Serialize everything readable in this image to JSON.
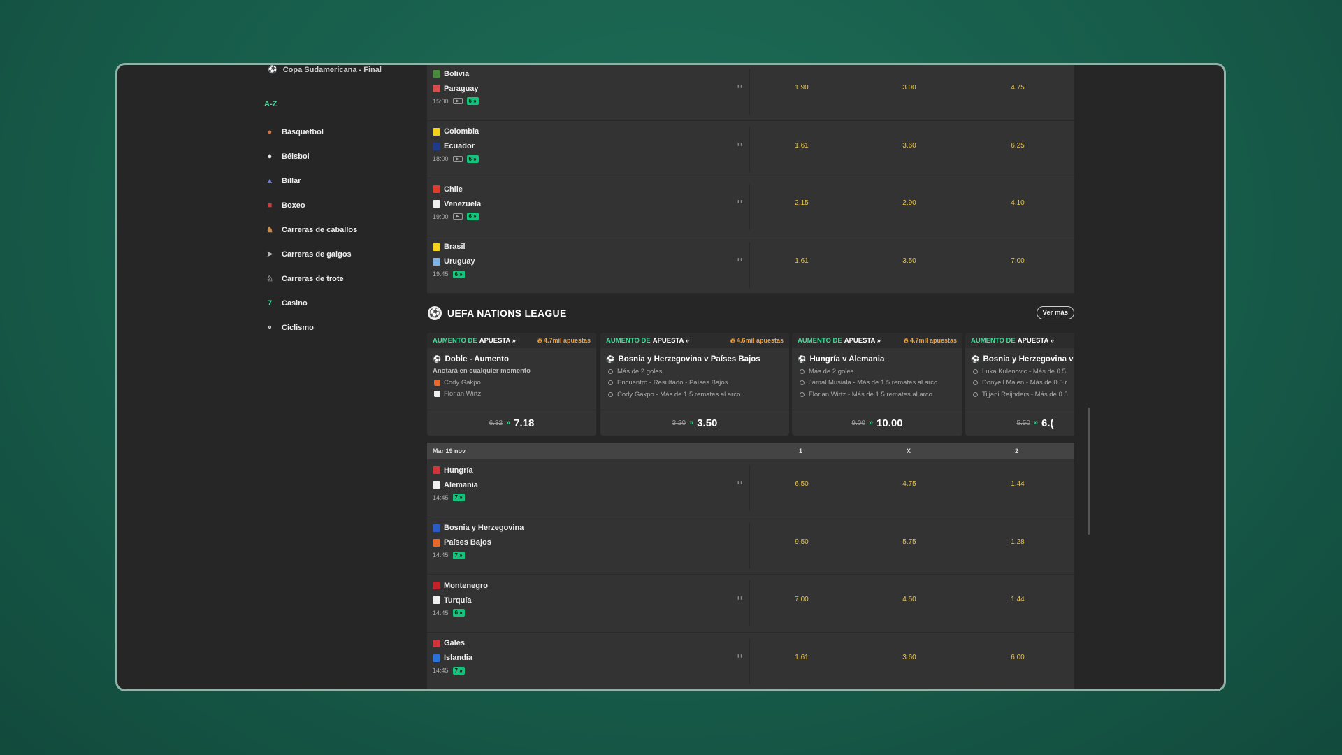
{
  "sidebar": {
    "top_item": "Copa Sudamericana - Final",
    "az_label": "A-Z",
    "sports": [
      {
        "label": "Básquetbol",
        "icon": "basketball-icon",
        "color": "#d9743c"
      },
      {
        "label": "Béisbol",
        "icon": "baseball-icon",
        "color": "#e9e9e9"
      },
      {
        "label": "Billar",
        "icon": "billiards-icon",
        "color": "#6c7bd8"
      },
      {
        "label": "Boxeo",
        "icon": "boxing-glove-icon",
        "color": "#d23a3a"
      },
      {
        "label": "Carreras de caballos",
        "icon": "horse-icon",
        "color": "#c98a4a"
      },
      {
        "label": "Carreras de galgos",
        "icon": "greyhound-icon",
        "color": "#b9b9b9"
      },
      {
        "label": "Carreras de trote",
        "icon": "trotting-icon",
        "color": "#999999"
      },
      {
        "label": "Casino",
        "icon": "slot-777-icon",
        "color": "#3ddc97"
      },
      {
        "label": "Ciclismo",
        "icon": "bicycle-icon",
        "color": "#cccccc"
      }
    ]
  },
  "top_matches": [
    {
      "home": "Bolivia",
      "away": "Paraguay",
      "time": "15:00",
      "tv": true,
      "markets": "6 »",
      "stats": true,
      "odd1": "1.90",
      "oddx": "3.00",
      "odd2": "4.75",
      "home_color": "#4a8a3c",
      "away_color": "#d94c4c"
    },
    {
      "home": "Colombia",
      "away": "Ecuador",
      "time": "18:00",
      "tv": true,
      "markets": "6 »",
      "stats": true,
      "odd1": "1.61",
      "oddx": "3.60",
      "odd2": "6.25",
      "home_color": "#f2d21c",
      "away_color": "#1f3a8a"
    },
    {
      "home": "Chile",
      "away": "Venezuela",
      "time": "19:00",
      "tv": true,
      "markets": "6 »",
      "stats": true,
      "odd1": "2.15",
      "oddx": "2.90",
      "odd2": "4.10",
      "home_color": "#e03a2c",
      "away_color": "#f0f0f0"
    },
    {
      "home": "Brasil",
      "away": "Uruguay",
      "time": "19:45",
      "tv": false,
      "markets": "6 »",
      "stats": true,
      "odd1": "1.61",
      "oddx": "3.50",
      "odd2": "7.00",
      "home_color": "#f2d21c",
      "away_color": "#7fb4e8"
    }
  ],
  "league": {
    "title": "UEFA NATIONS LEAGUE",
    "more": "Ver más"
  },
  "boosts": [
    {
      "tag_a": "AUMENTO DE",
      "tag_b": "APUESTA »",
      "pop": "4.7mil apuestas",
      "title": "Doble - Aumento",
      "subtitle": "Anotará en cualquier momento",
      "legs": [
        "Cody Gakpo",
        "Florian Wirtz"
      ],
      "leg_colors": [
        "#e8692a",
        "#f0f0f0"
      ],
      "old": "6.32",
      "new": "7.18"
    },
    {
      "tag_a": "AUMENTO DE",
      "tag_b": "APUESTA »",
      "pop": "4.6mil apuestas",
      "title": "Bosnia y Herzegovina v Países Bajos",
      "subtitle": "",
      "legs": [
        "Más de 2 goles",
        "Encuentro - Resultado - Países Bajos",
        "Cody Gakpo - Más de 1.5 remates al arco"
      ],
      "old": "3.20",
      "new": "3.50"
    },
    {
      "tag_a": "AUMENTO DE",
      "tag_b": "APUESTA »",
      "pop": "4.7mil apuestas",
      "title": "Hungría v Alemania",
      "subtitle": "",
      "legs": [
        "Más de 2 goles",
        "Jamal Musiala - Más de 1.5 remates al arco",
        "Florian Wirtz - Más de 1.5 remates al arco"
      ],
      "old": "9.00",
      "new": "10.00"
    },
    {
      "tag_a": "AUMENTO DE",
      "tag_b": "APUESTA »",
      "pop": "",
      "title": "Bosnia y Herzegovina v",
      "subtitle": "",
      "legs": [
        "Luka Kulenovic - Más de 0.5",
        "Donyell Malen - Más de 0.5 r",
        "Tijjani Reijnders - Más de 0.5"
      ],
      "old": "5.50",
      "new": "6.("
    }
  ],
  "day_header": {
    "date": "Mar 19 nov",
    "col1": "1",
    "colx": "X",
    "col2": "2"
  },
  "nations_matches": [
    {
      "home": "Hungría",
      "away": "Alemania",
      "time": "14:45",
      "markets": "7 »",
      "stats": true,
      "odd1": "6.50",
      "oddx": "4.75",
      "odd2": "1.44",
      "home_color": "#d2343a",
      "away_color": "#f0f0f0"
    },
    {
      "home": "Bosnia y Herzegovina",
      "away": "Países Bajos",
      "time": "14:45",
      "markets": "7 »",
      "stats": false,
      "odd1": "9.50",
      "oddx": "5.75",
      "odd2": "1.28",
      "home_color": "#2a5cc8",
      "away_color": "#e8692a"
    },
    {
      "home": "Montenegro",
      "away": "Turquía",
      "time": "14:45",
      "markets": "6 »",
      "stats": true,
      "odd1": "7.00",
      "oddx": "4.50",
      "odd2": "1.44",
      "home_color": "#c2222a",
      "away_color": "#f0f0f0"
    },
    {
      "home": "Gales",
      "away": "Islandia",
      "time": "14:45",
      "markets": "7 »",
      "stats": true,
      "odd1": "1.61",
      "oddx": "3.60",
      "odd2": "6.00",
      "home_color": "#d2343a",
      "away_color": "#2a72d8"
    }
  ]
}
